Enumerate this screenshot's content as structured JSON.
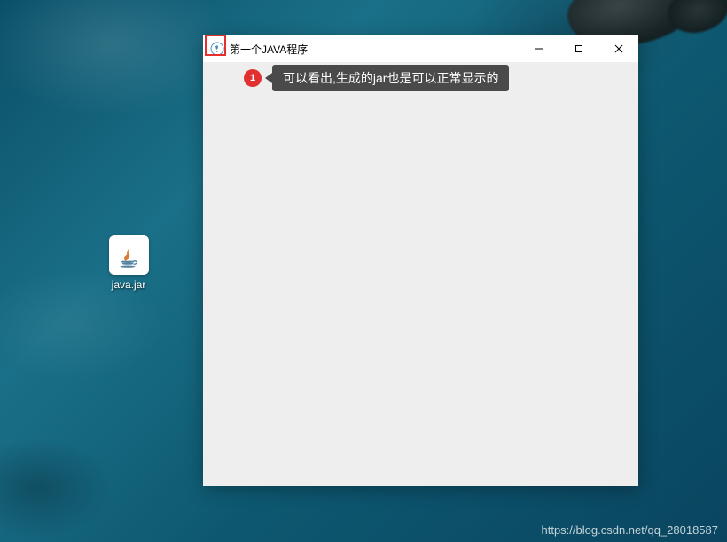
{
  "desktop": {
    "icon_label": "java.jar"
  },
  "window": {
    "title": "第一个JAVA程序",
    "controls": {
      "minimize_glyph": "—",
      "maximize_label": "maximize",
      "close_glyph": "✕"
    }
  },
  "annotation": {
    "number": "1",
    "text": "可以看出,生成的jar也是可以正常显示的"
  },
  "watermark": "https://blog.csdn.net/qq_28018587"
}
